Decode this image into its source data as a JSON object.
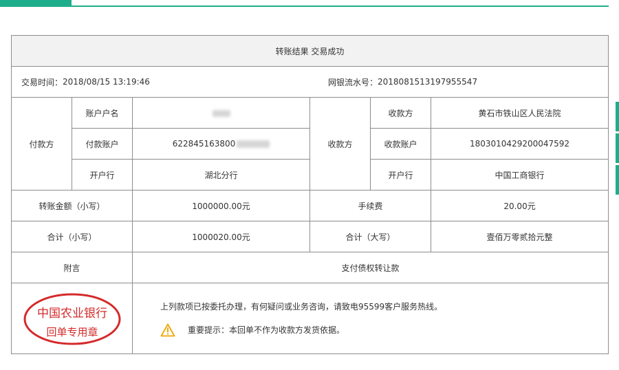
{
  "title": "转账结果 交易成功",
  "transaction": {
    "time_label": "交易时间：",
    "time_value": "2018/08/15 13:19:46",
    "serial_label": "网银流水号：",
    "serial_value": "2018081513197955547"
  },
  "payer": {
    "group_label": "付款方",
    "name_label": "账户户名",
    "account_label": "付款账户",
    "account_value": "622845163800",
    "bank_label": "开户行",
    "bank_value": "湖北分行"
  },
  "payee": {
    "group_label": "收款方",
    "name_label": "收款方",
    "name_value": "黄石市铁山区人民法院",
    "account_label": "收款账户",
    "account_value": "1803010429200047592",
    "bank_label": "开户行",
    "bank_value": "中国工商银行"
  },
  "amounts": {
    "amount_label": "转账金额（小写）",
    "amount_value": "1000000.00元",
    "fee_label": "手续费",
    "fee_value": "20.00元",
    "total_label": "合计（小写）",
    "total_value": "1000020.00元",
    "total_upper_label": "合计（大写）",
    "total_upper_value": "壹佰万零贰拾元整"
  },
  "memo": {
    "label": "附言",
    "value": "支付债权转让款"
  },
  "notes": {
    "line1": "上列款项已按委托办理，有何疑问或业务咨询，请致电95599客户服务热线。",
    "line2": "重要提示：本回单不作为收款方发货依据。"
  },
  "seal": {
    "top_text": "中国农业银行",
    "bottom_text": "回单专用章",
    "color": "#d42a2a"
  },
  "colors": {
    "accent": "#1fae8b",
    "header_bg": "#f2f2f2",
    "warning": "#f0a500"
  }
}
